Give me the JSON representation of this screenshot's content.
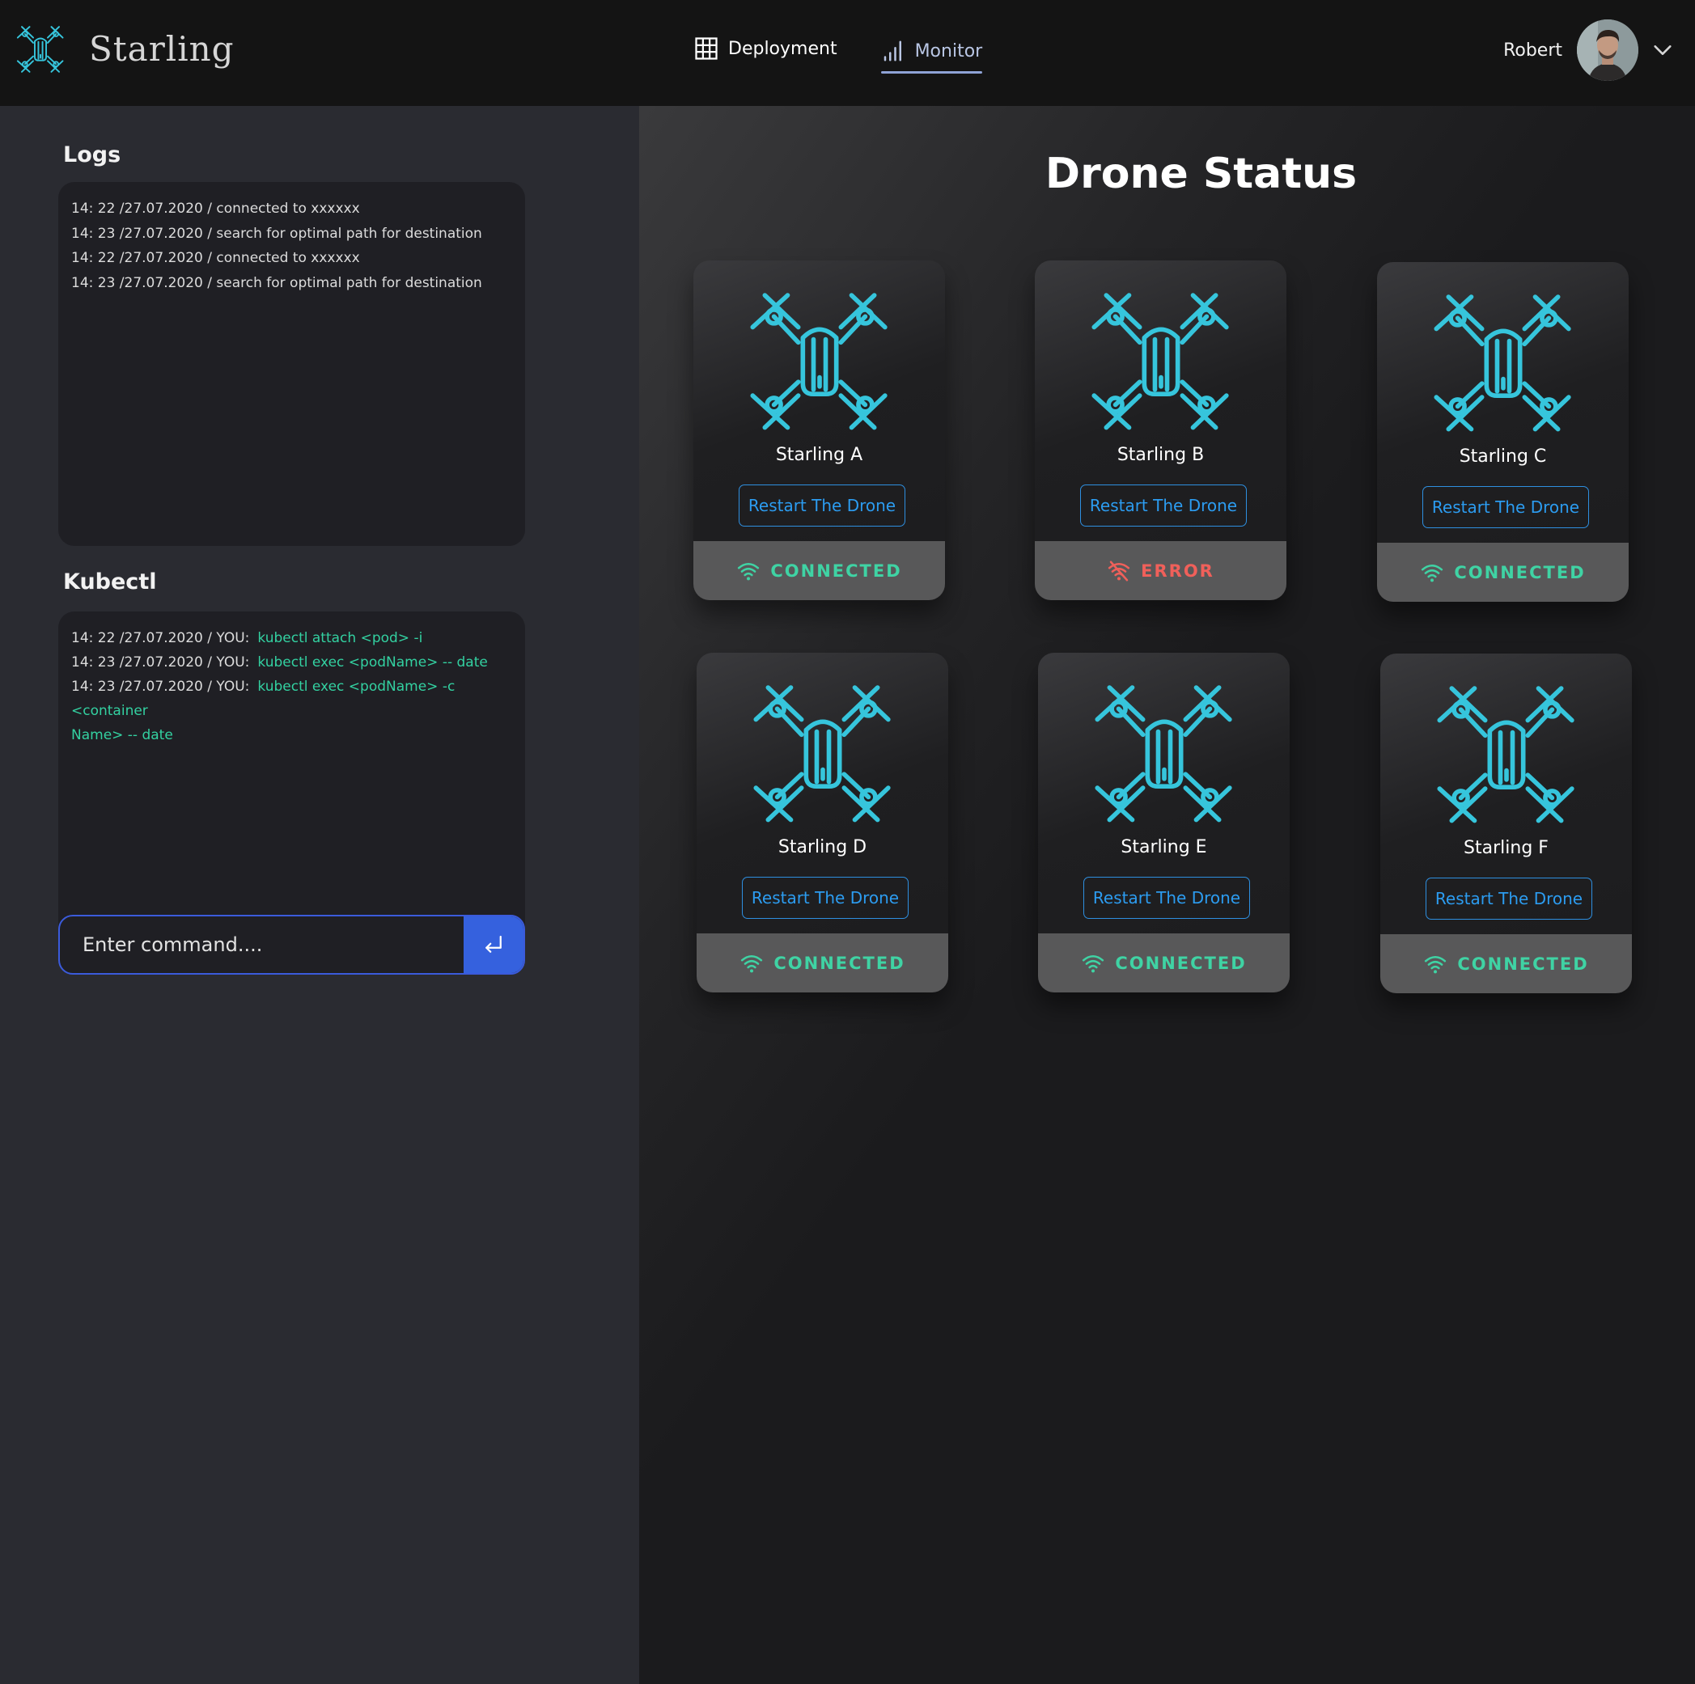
{
  "app": {
    "name": "Starling",
    "brand_color": "#36c5dc"
  },
  "nav": {
    "deployment": "Deployment",
    "monitor": "Monitor",
    "active": "monitor"
  },
  "user": {
    "name": "Robert"
  },
  "logs": {
    "title": "Logs",
    "lines": [
      "14: 22 /27.07.2020 / connected to xxxxxx",
      "14: 23 /27.07.2020 / search for optimal path for destination",
      "14: 22 /27.07.2020 / connected to xxxxxx",
      "14: 23 /27.07.2020 / search for optimal path for destination"
    ]
  },
  "kubectl": {
    "title": "Kubectl",
    "lines": [
      {
        "prefix": "14: 22 /27.07.2020 / YOU:",
        "command": "kubectl attach <pod> -i"
      },
      {
        "prefix": "14: 23 /27.07.2020 / YOU:",
        "command": "kubectl exec <podName> -- date"
      },
      {
        "prefix": "14: 23 /27.07.2020 / YOU:",
        "command": "kubectl exec <podName> -c <container"
      }
    ],
    "continuation": "Name> -- date",
    "input_placeholder": "Enter command...."
  },
  "drone_status": {
    "title": "Drone Status",
    "restart_label": "Restart The Drone",
    "connected_color": "#3fd3a4",
    "error_color": "#f0605a",
    "drones": [
      {
        "name": "Starling A",
        "status": "CONNECTED"
      },
      {
        "name": "Starling B",
        "status": "ERROR"
      },
      {
        "name": "Starling C",
        "status": "CONNECTED"
      },
      {
        "name": "Starling D",
        "status": "CONNECTED"
      },
      {
        "name": "Starling E",
        "status": "CONNECTED"
      },
      {
        "name": "Starling F",
        "status": "CONNECTED"
      }
    ]
  }
}
